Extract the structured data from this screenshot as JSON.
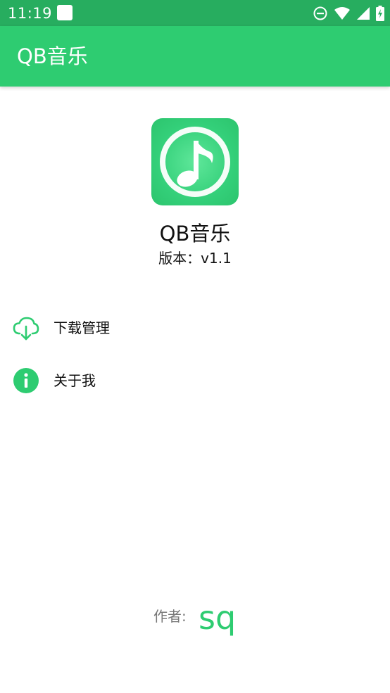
{
  "status_bar": {
    "time": "11:19",
    "icons": [
      "notification-square-icon",
      "do-not-disturb-icon",
      "wifi-icon",
      "signal-icon",
      "battery-charging-icon"
    ]
  },
  "app_bar": {
    "title": "QB音乐"
  },
  "app_info": {
    "icon": "music-note-icon",
    "name": "QB音乐",
    "version": "版本：v1.1"
  },
  "menu": {
    "items": [
      {
        "label": "下载管理",
        "icon": "cloud-download-icon"
      },
      {
        "label": "关于我",
        "icon": "info-icon"
      }
    ]
  },
  "author": {
    "label": "作者:",
    "name": "sq"
  },
  "colors": {
    "status_bar": "#27ad5f",
    "primary": "#2ecc71",
    "text": "#111111",
    "secondary_text": "#777777"
  }
}
